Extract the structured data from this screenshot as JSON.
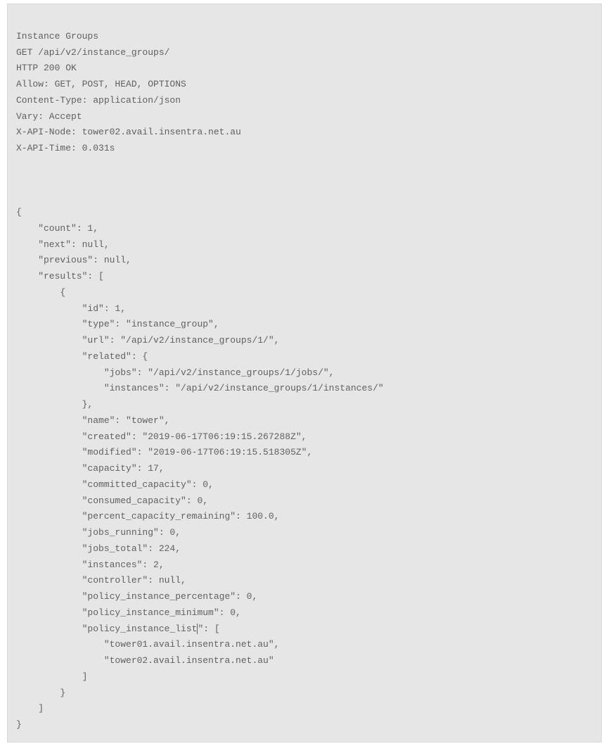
{
  "header": {
    "title": "Instance Groups",
    "request_line": "GET /api/v2/instance_groups/",
    "status_line": "HTTP 200 OK",
    "headers": {
      "allow": "Allow: GET, POST, HEAD, OPTIONS",
      "content_type": "Content-Type: application/json",
      "vary": "Vary: Accept",
      "x_api_node": "X-API-Node: tower02.avail.insentra.net.au",
      "x_api_time": "X-API-Time: 0.031s"
    }
  },
  "body": {
    "open": "{",
    "count_line": "    \"count\": 1,",
    "next_line": "    \"next\": null,",
    "previous_line": "    \"previous\": null,",
    "results_open": "    \"results\": [",
    "item_open": "        {",
    "id_line": "            \"id\": 1,",
    "type_line": "            \"type\": \"instance_group\",",
    "url_line": "            \"url\": \"/api/v2/instance_groups/1/\",",
    "related_open": "            \"related\": {",
    "related_jobs": "                \"jobs\": \"/api/v2/instance_groups/1/jobs/\",",
    "related_instances": "                \"instances\": \"/api/v2/instance_groups/1/instances/\"",
    "related_close": "            },",
    "name_line": "            \"name\": \"tower\",",
    "created_line": "            \"created\": \"2019-06-17T06:19:15.267288Z\",",
    "modified_line": "            \"modified\": \"2019-06-17T06:19:15.518305Z\",",
    "capacity_line": "            \"capacity\": 17,",
    "committed_line": "            \"committed_capacity\": 0,",
    "consumed_line": "            \"consumed_capacity\": 0,",
    "percent_line": "            \"percent_capacity_remaining\": 100.0,",
    "jobs_running_line": "            \"jobs_running\": 0,",
    "jobs_total_line": "            \"jobs_total\": 224,",
    "instances_line": "            \"instances\": 2,",
    "controller_line": "            \"controller\": null,",
    "policy_pct_line": "            \"policy_instance_percentage\": 0,",
    "policy_min_line": "            \"policy_instance_minimum\": 0,",
    "policy_list_open_prefix": "            \"policy_instance_list",
    "policy_list_open_suffix": "\": [",
    "policy_item1": "                \"tower01.avail.insentra.net.au\",",
    "policy_item2": "                \"tower02.avail.insentra.net.au\"",
    "policy_list_close": "            ]",
    "item_close": "        }",
    "results_close": "    ]",
    "close": "}"
  }
}
